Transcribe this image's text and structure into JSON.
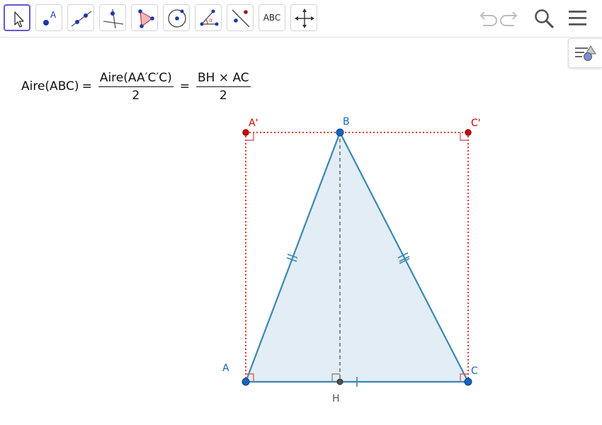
{
  "toolbar": {
    "tools": [
      {
        "name": "move-tool",
        "icon": "arrow-cursor-icon"
      },
      {
        "name": "point-tool",
        "icon": "point-icon",
        "glyph": "A"
      },
      {
        "name": "line-tool",
        "icon": "line-through-points-icon"
      },
      {
        "name": "perpendicular-tool",
        "icon": "perpendicular-line-icon"
      },
      {
        "name": "polygon-tool",
        "icon": "polygon-icon"
      },
      {
        "name": "circle-tool",
        "icon": "circle-center-point-icon"
      },
      {
        "name": "angle-tool",
        "icon": "angle-icon",
        "glyph": "α"
      },
      {
        "name": "reflect-tool",
        "icon": "reflect-line-icon"
      },
      {
        "name": "text-tool",
        "icon": "text-icon",
        "label": "ABC"
      },
      {
        "name": "move-graphics-tool",
        "icon": "move-graphics-icon"
      }
    ],
    "right": [
      "undo-icon",
      "redo-icon",
      "search-icon",
      "menu-icon"
    ],
    "style_bar": "style-bar-icon"
  },
  "formula": {
    "lhs": "Aire(ABC)",
    "eq1": "=",
    "frac1_num": "Aire(AA′C′C)",
    "frac1_den": "2",
    "eq2": "=",
    "frac2_num": "BH × AC",
    "frac2_den": "2"
  },
  "points": {
    "A": {
      "label": "A",
      "color": "#1565c0"
    },
    "B": {
      "label": "B",
      "color": "#1565c0"
    },
    "C": {
      "label": "C",
      "color": "#1565c0"
    },
    "A1": {
      "label": "A'",
      "color": "#cc0000"
    },
    "C1": {
      "label": "C'",
      "color": "#cc0000"
    },
    "H": {
      "label": "H",
      "color": "#555555"
    }
  },
  "colors": {
    "triangle_stroke": "#3a87b4",
    "triangle_fill": "#e3edf5",
    "rectangle_stroke": "#e53935",
    "altitude": "#666666",
    "accent": "#6557d2"
  }
}
